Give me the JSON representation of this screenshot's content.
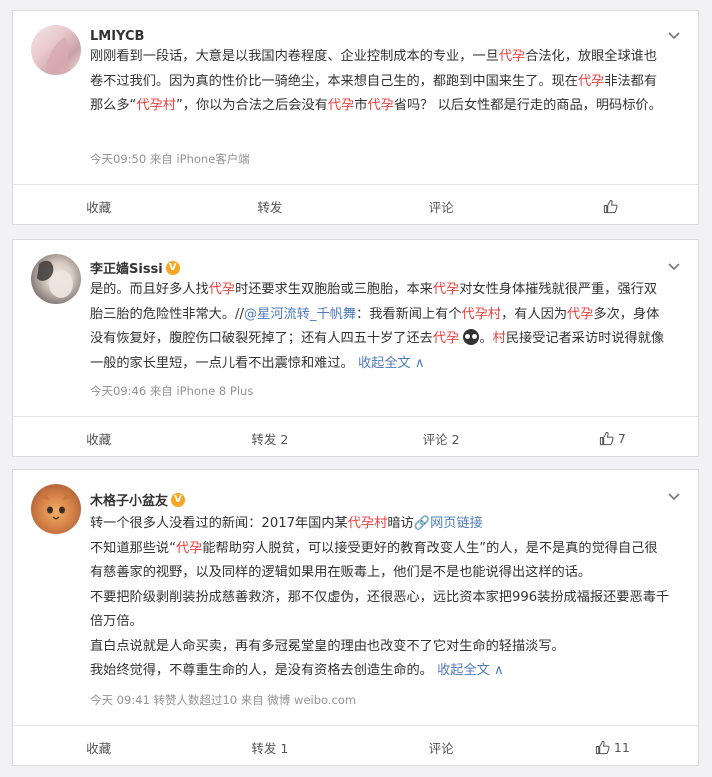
{
  "posts": [
    {
      "username": "LMIYCB",
      "content_segments": [
        {
          "t": "刚刚看到一段话，大意是以我国内卷程度、企业控制成本的专业，一旦",
          "c": "n"
        },
        {
          "t": "代孕",
          "c": "h"
        },
        {
          "t": "合法化，放眼全球谁也卷不过我们。因为真的性价比一骑绝尘，本来想自己生的，都跑到中国来生了。现在",
          "c": "n"
        },
        {
          "t": "代孕",
          "c": "h"
        },
        {
          "t": "非法都有那么多“",
          "c": "n"
        },
        {
          "t": "代孕村",
          "c": "h"
        },
        {
          "t": "”，你以为合法之后会没有",
          "c": "n"
        },
        {
          "t": "代孕",
          "c": "h"
        },
        {
          "t": "市",
          "c": "n"
        },
        {
          "t": "代孕",
          "c": "h"
        },
        {
          "t": "省吗？ 以后女性都是行走的商品，明码标价。",
          "c": "n"
        }
      ],
      "meta": "今天09:50  来自 iPhone客户端",
      "actions": {
        "fav": "收藏",
        "repost": "转发",
        "comment": "评论",
        "like": ""
      }
    },
    {
      "username": "李正嫱Sissi",
      "badge": "V",
      "content_segments": [
        {
          "t": "是的。而且好多人找",
          "c": "n"
        },
        {
          "t": "代孕",
          "c": "h"
        },
        {
          "t": "时还要求生双胞胎或三胞胎，本来",
          "c": "n"
        },
        {
          "t": "代孕",
          "c": "h"
        },
        {
          "t": "对女性身体摧残就很严重，强行双胎三胎的危险性非常大。//",
          "c": "n"
        },
        {
          "t": "@星河流转_千帆舞",
          "c": "l"
        },
        {
          "t": "：我看新闻上有个",
          "c": "n"
        },
        {
          "t": "代孕村",
          "c": "h"
        },
        {
          "t": "，有人因为",
          "c": "n"
        },
        {
          "t": "代孕",
          "c": "h"
        },
        {
          "t": "多次，身体没有恢复好，腹腔伤口破裂死掉了；还有人四五十岁了还去",
          "c": "n"
        },
        {
          "t": "代孕",
          "c": "h"
        },
        {
          "t": " ",
          "c": "n"
        },
        {
          "t": "",
          "c": "e"
        },
        {
          "t": "。",
          "c": "n"
        },
        {
          "t": "村",
          "c": "h"
        },
        {
          "t": "民接受记者采访时说得就像一般的家长里短，一点儿看不出震惊和难过。 ",
          "c": "n"
        },
        {
          "t": "收起全文 ∧",
          "c": "l"
        }
      ],
      "meta": "今天09:46  来自 iPhone 8 Plus",
      "actions": {
        "fav": "收藏",
        "repost": "转发 2",
        "comment": "评论 2",
        "like": "7"
      }
    },
    {
      "username": "木格子小盆友",
      "badge": "V",
      "paragraphs": [
        [
          {
            "t": "转一个很多人没看过的新闻：2017年国内某",
            "c": "n"
          },
          {
            "t": "代孕村",
            "c": "h"
          },
          {
            "t": "暗访",
            "c": "n"
          },
          {
            "t": "🔗网页链接",
            "c": "l"
          }
        ],
        [
          {
            "t": "不知道那些说“",
            "c": "n"
          },
          {
            "t": "代孕",
            "c": "h"
          },
          {
            "t": "能帮助穷人脱贫，可以接受更好的教育改变人生”的人，是不是真的觉得自己很有慈善家的视野，以及同样的逻辑如果用在贩毒上，他们是不是也能说得出这样的话。",
            "c": "n"
          }
        ],
        [
          {
            "t": "不要把阶级剥削装扮成慈善救济，那不仅虚伪，还很恶心，远比资本家把996装扮成福报还要恶毒千倍万倍。",
            "c": "n"
          }
        ],
        [
          {
            "t": "直白点说就是人命买卖，再有多冠冕堂皇的理由也改变不了它对生命的轻描淡写。",
            "c": "n"
          }
        ],
        [
          {
            "t": "我始终觉得，不尊重生命的人，是没有资格去创造生命的。 ",
            "c": "n"
          },
          {
            "t": "收起全文 ∧",
            "c": "l"
          }
        ]
      ],
      "meta": "今天 09:41  转赞人数超过10  来自 微博 weibo.com",
      "actions": {
        "fav": "收藏",
        "repost": "转发 1",
        "comment": "评论",
        "like": "11"
      }
    }
  ],
  "colors": {
    "highlight": "#e8413f",
    "link": "#4f7bbd",
    "badge": "#f5a623",
    "meta": "#939393"
  }
}
